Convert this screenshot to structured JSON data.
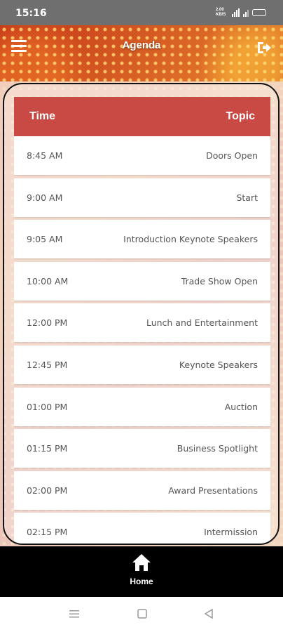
{
  "status": {
    "time": "15:16",
    "net_speed": "2.00 KB/S"
  },
  "header": {
    "title": "Agenda"
  },
  "table": {
    "col_time": "Time",
    "col_topic": "Topic",
    "rows": [
      {
        "time": "8:45 AM",
        "topic": "Doors Open"
      },
      {
        "time": "9:00 AM",
        "topic": "Start"
      },
      {
        "time": "9:05 AM",
        "topic": "Introduction Keynote Speakers"
      },
      {
        "time": "10:00 AM",
        "topic": "Trade Show Open"
      },
      {
        "time": "12:00 PM",
        "topic": "Lunch and Entertainment"
      },
      {
        "time": "12:45 PM",
        "topic": "Keynote Speakers"
      },
      {
        "time": "01:00 PM",
        "topic": "Auction"
      },
      {
        "time": "01:15 PM",
        "topic": "Business Spotlight"
      },
      {
        "time": "02:00 PM",
        "topic": "Award Presentations"
      },
      {
        "time": "02:15 PM",
        "topic": "Intermission"
      }
    ]
  },
  "bottom_nav": {
    "home_label": "Home"
  },
  "colors": {
    "header_red": "#c94a45",
    "nav_black": "#000000",
    "status_gray": "#6f6f6f"
  },
  "icons": {
    "menu": "hamburger-icon",
    "logout": "logout-icon",
    "home": "home-icon"
  }
}
